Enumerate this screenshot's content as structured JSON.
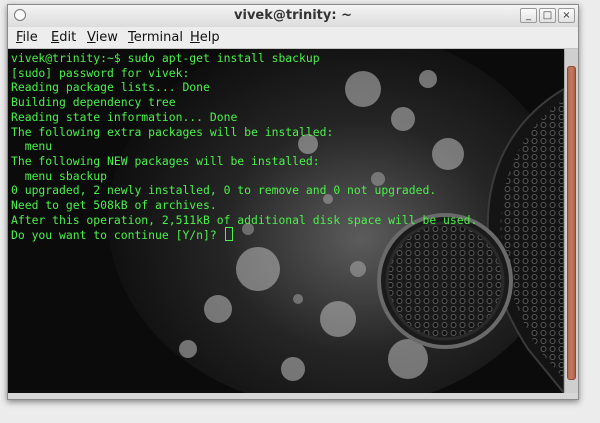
{
  "window": {
    "title": "vivek@trinity: ~",
    "buttons": {
      "minimize": "_",
      "maximize": "□",
      "close": "×"
    }
  },
  "menubar": {
    "items": [
      {
        "label": "File",
        "accel": "F",
        "rest": "ile"
      },
      {
        "label": "Edit",
        "accel": "E",
        "rest": "dit"
      },
      {
        "label": "View",
        "accel": "V",
        "rest": "iew"
      },
      {
        "label": "Terminal",
        "accel": "T",
        "rest": "erminal"
      },
      {
        "label": "Help",
        "accel": "H",
        "rest": "elp"
      }
    ]
  },
  "terminal": {
    "text_color": "#4cf04c",
    "lines": [
      "vivek@trinity:~$ sudo apt-get install sbackup",
      "[sudo] password for vivek:",
      "Reading package lists... Done",
      "Building dependency tree",
      "Reading state information... Done",
      "The following extra packages will be installed:",
      "  menu",
      "The following NEW packages will be installed:",
      "  menu sbackup",
      "0 upgraded, 2 newly installed, 0 to remove and 0 not upgraded.",
      "Need to get 508kB of archives.",
      "After this operation, 2,511kB of additional disk space will be used.",
      "Do you want to continue [Y/n]? "
    ]
  },
  "scrollbar": {
    "thumb_color": "#c97a5e"
  }
}
